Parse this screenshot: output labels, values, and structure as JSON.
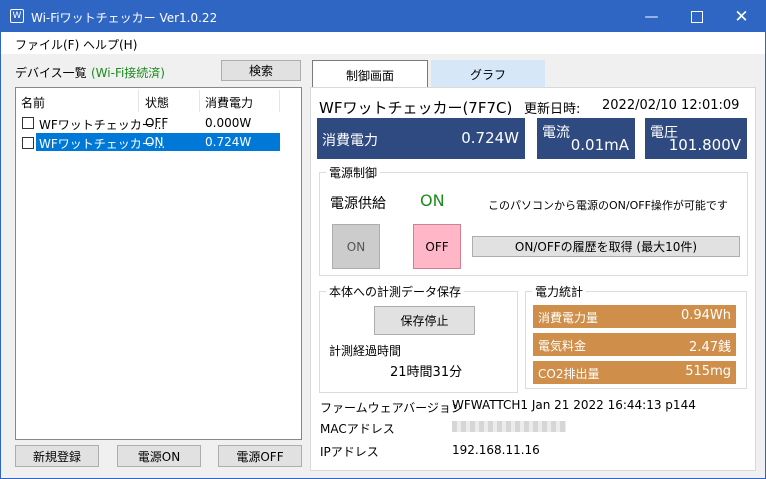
{
  "window": {
    "title": "Wi-Fiワットチェッカー Ver1.0.22",
    "icon_text": "W"
  },
  "menu": {
    "file": "ファイル(F)",
    "help": "ヘルプ(H)"
  },
  "device_list": {
    "heading": "デバイス一覧",
    "status": "(Wi-Fi接続済)",
    "search_label": "検索",
    "columns": {
      "name": "名前",
      "state": "状態",
      "power": "消費電力"
    },
    "rows": [
      {
        "name": "WFワットチェッカー...",
        "state": "OFF",
        "power": "0.000W",
        "checked": false,
        "selected": false
      },
      {
        "name": "WFワットチェッカー...",
        "state": "ON",
        "power": "0.724W",
        "checked": false,
        "selected": true
      }
    ]
  },
  "bottom_buttons": {
    "register": "新規登録",
    "power_on": "電源ON",
    "power_off": "電源OFF"
  },
  "tabs": {
    "control": "制御画面",
    "graph": "グラフ"
  },
  "control": {
    "device_title": "WFワットチェッカー(7F7C)",
    "updated_label": "更新日時:",
    "updated_value": "2022/02/10 12:01:09",
    "power": {
      "label": "消費電力",
      "value": "0.724W"
    },
    "current": {
      "label": "電流",
      "value": "0.01mA"
    },
    "voltage": {
      "label": "電圧",
      "value": "101.800V"
    },
    "power_control": {
      "title": "電源制御",
      "supply_label": "電源供給",
      "supply_state": "ON",
      "note": "このパソコンから電源のON/OFF操作が可能です",
      "on_label": "ON",
      "off_label": "OFF",
      "history_label": "ON/OFFの履歴を取得 (最大10件)"
    },
    "save": {
      "title": "本体への計測データ保存",
      "stop_label": "保存停止",
      "elapsed_label": "計測経過時間",
      "elapsed_value": "21時間31分"
    },
    "stats": {
      "title": "電力統計",
      "items": [
        {
          "label": "消費電力量",
          "value": "0.94Wh"
        },
        {
          "label": "電気料金",
          "value": "2.47銭"
        },
        {
          "label": "CO2排出量",
          "value": "515mg"
        }
      ]
    },
    "info": {
      "firmware_label": "ファームウェアバージョン",
      "firmware_value": "WFWATTCH1 Jan 21 2022 16:44:13 p144",
      "mac_label": "MACアドレス",
      "ip_label": "IPアドレス",
      "ip_value": "192.168.11.16"
    }
  },
  "colors": {
    "titlebar": "#2f66c3",
    "tile": "#2e4a80",
    "stat": "#cf8e4a",
    "on_green": "#1c8a1c",
    "off_pink": "#ffb6c6",
    "selection": "#0078d7"
  }
}
